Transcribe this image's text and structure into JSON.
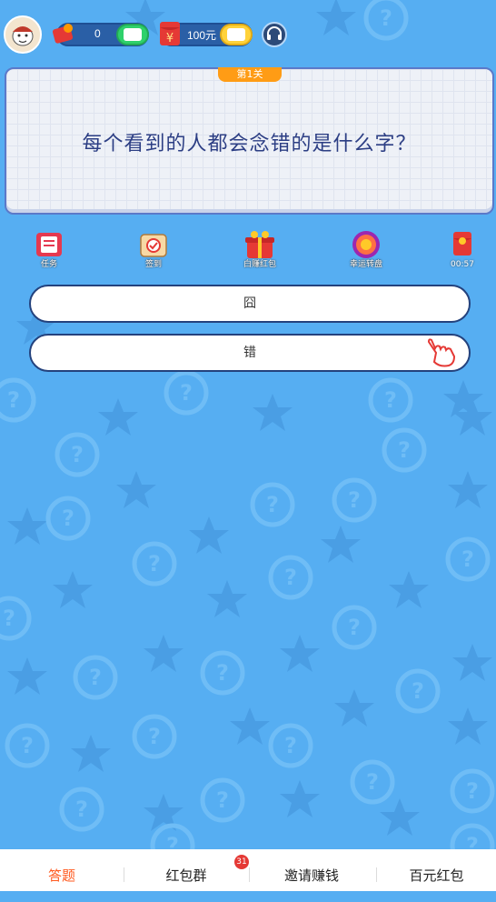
{
  "header": {
    "red_envelope_count": "0",
    "cash_amount": "100元"
  },
  "card": {
    "level": "第1关",
    "question": "每个看到的人都会念错的是什么字？"
  },
  "features": [
    {
      "label": "任务",
      "icon": "task-icon"
    },
    {
      "label": "签到",
      "icon": "checkin-icon"
    },
    {
      "label": "白赚红包",
      "icon": "gift-box-icon"
    },
    {
      "label": "幸运转盘",
      "icon": "lucky-wheel-icon"
    }
  ],
  "timer": {
    "value": "00:57"
  },
  "answers": [
    "囧",
    "错"
  ],
  "bottom_nav": {
    "items": [
      "答题",
      "红包群",
      "邀请赚钱",
      "百元红包"
    ],
    "badge": "31"
  },
  "colors": {
    "background": "#56aef2",
    "accent": "#ff5a1f",
    "badge_orange": "#ff9c15",
    "answer_border": "#24427d"
  }
}
